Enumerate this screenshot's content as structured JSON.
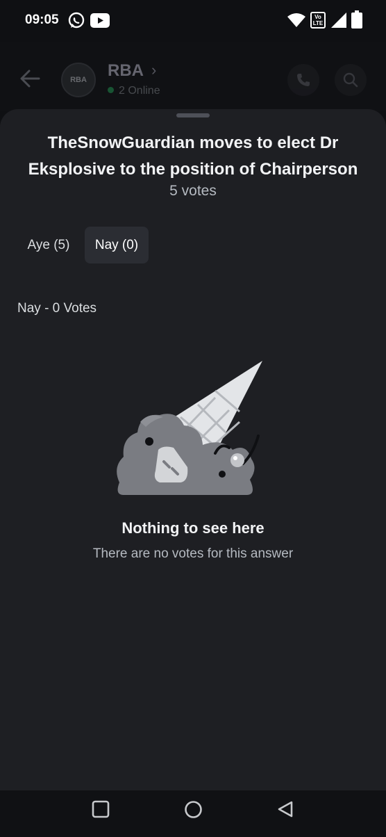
{
  "status_bar": {
    "time": "09:05",
    "icons": [
      "whatsapp-icon",
      "youtube-icon",
      "wifi-icon",
      "volte-icon",
      "signal-icon",
      "battery-icon"
    ],
    "volte_text": "Vo\nLTE"
  },
  "header": {
    "avatar_text": "RBA",
    "channel_name": "RBA",
    "online_text": "2 Online"
  },
  "poll": {
    "question": "TheSnowGuardian moves to elect Dr Eksplosive to the position of Chairperson",
    "total_votes": "5 votes",
    "tabs": [
      {
        "label": "Aye (5)",
        "active": false
      },
      {
        "label": "Nay (0)",
        "active": true
      }
    ],
    "section_label": "Nay - 0 Votes",
    "empty_title": "Nothing to see here",
    "empty_subtitle": "There are no votes for this answer"
  },
  "colors": {
    "background": "#0f1013",
    "sheet": "#1e1f23",
    "active_tab": "#2b2d33",
    "online": "#23a55a"
  }
}
